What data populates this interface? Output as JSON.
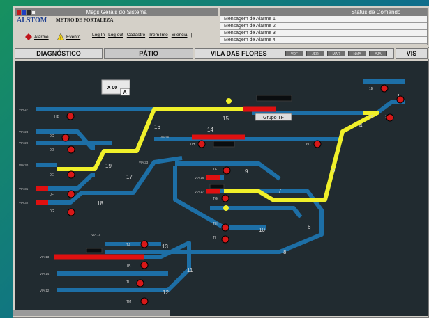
{
  "header": {
    "msgs_title": "Msgs Gerais do Sistema",
    "brand": "ALSTOM",
    "brand_sub": "METRO DE FORTALEZA",
    "alarme_label": "Alarme",
    "evento_label": "Evento",
    "menu": [
      "Log In",
      "Log out",
      "Cadastro",
      "Trem Info",
      "Silencia",
      "|"
    ]
  },
  "status": {
    "title": "Status de Comando",
    "alarms": [
      "Mensagem de Alarme 1",
      "Mensagem de Alarme 2",
      "Mensagem de Alarme 3",
      "Mensagem de Alarme 4"
    ]
  },
  "tabs": {
    "diagnostico": "DIAGNÓSTICO",
    "patio": "PÁTIO",
    "vila": "VILA DAS FLORES",
    "vis": "VIS",
    "chips": [
      "VDF",
      "JER",
      "MAR",
      "NMA",
      "AJA"
    ]
  },
  "yard": {
    "xbox": "X 00",
    "xbox_sub": "A",
    "grupo": "Grupo TF",
    "track_numbers": [
      "1",
      "4",
      "5",
      "6",
      "7",
      "8",
      "9",
      "10",
      "11",
      "12",
      "13",
      "14",
      "15",
      "16",
      "17",
      "18",
      "19"
    ],
    "signals": [
      "1B",
      "1C",
      "2C",
      "HB",
      "0C",
      "0D",
      "0E",
      "0F",
      "0G",
      "0H",
      "6D",
      "TF",
      "TG",
      "TH",
      "TI",
      "TJ",
      "TK",
      "TL",
      "TM"
    ],
    "via_labels": [
      "VIA 27",
      "VIA 28",
      "VIA 29",
      "VIA 30",
      "VIA 31",
      "VIA 32",
      "VIA 26",
      "VIA 23",
      "VIA 16",
      "VIA 17",
      "VIA 15",
      "VIA 13",
      "VIA 14",
      "VIA 12"
    ]
  },
  "colors": {
    "background": "#212b30",
    "track": "#1d6fa6",
    "route": "#f0f02a",
    "occupied": "#e01010",
    "signal": "#d81818"
  }
}
